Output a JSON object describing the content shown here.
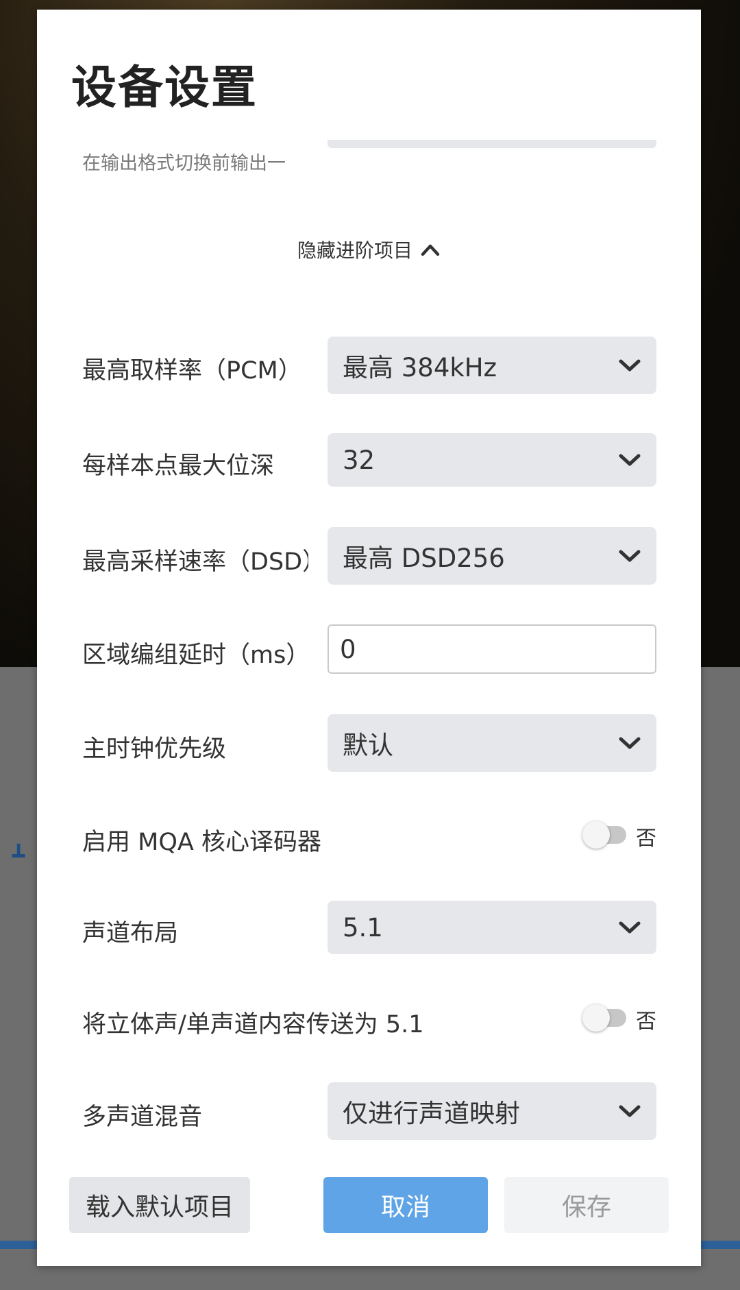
{
  "dialog": {
    "title": "设备设置"
  },
  "advanced": {
    "faded_label": "在输出格式切换前输出一",
    "toggle_label": "隐藏进阶项目"
  },
  "rows": {
    "max_sample_rate_pcm": {
      "label": "最高取样率（PCM）",
      "value": "最高 384kHz"
    },
    "max_bit_depth": {
      "label": "每样本点最大位深",
      "value": "32"
    },
    "max_sample_rate_dsd": {
      "label": "最高采样速率（DSD）",
      "value": "最高 DSD256"
    },
    "zone_group_delay": {
      "label": "区域编组延时（ms）",
      "value": "0"
    },
    "master_clock_priority": {
      "label": "主时钟优先级",
      "value": "默认"
    },
    "mqa_core_decoder": {
      "label": "启用 MQA 核心译码器",
      "state_text": "否",
      "enabled": false
    },
    "channel_layout": {
      "label": "声道布局",
      "value": "5.1"
    },
    "stereo_to_51": {
      "label": "将立体声/单声道内容传送为 5.1",
      "state_text": "否",
      "enabled": false
    },
    "multichannel_mix": {
      "label": "多声道混音",
      "value": "仅进行声道映射"
    }
  },
  "buttons": {
    "load_defaults": "载入默认项目",
    "cancel": "取消",
    "save": "保存"
  },
  "colors": {
    "primary": "#5ea4e6",
    "field_bg": "#e6e7ea",
    "dialog_bg": "#ffffff"
  }
}
